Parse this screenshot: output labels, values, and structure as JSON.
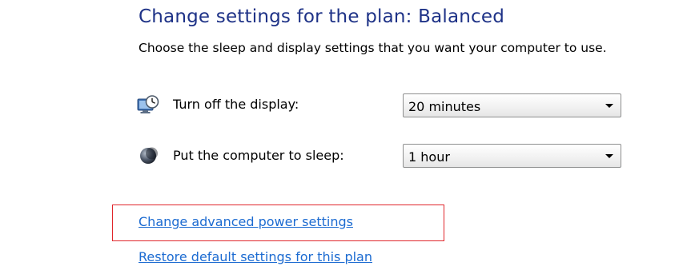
{
  "plan": {
    "title": "Change settings for the plan: Balanced",
    "description": "Choose the sleep and display settings that you want your computer to use."
  },
  "settings": [
    {
      "label": "Turn off the display:",
      "icon": "monitor-clock-icon",
      "selected": "20 minutes"
    },
    {
      "label": "Put the computer to sleep:",
      "icon": "moon-sleep-icon",
      "selected": "1 hour"
    }
  ],
  "links": {
    "advanced": "Change advanced power settings",
    "restore_access_key": "R",
    "restore_rest": "estore default settings for this plan"
  },
  "colors": {
    "title": "#1e3287",
    "link": "#1c6bd1",
    "highlight": "#e0262b"
  }
}
